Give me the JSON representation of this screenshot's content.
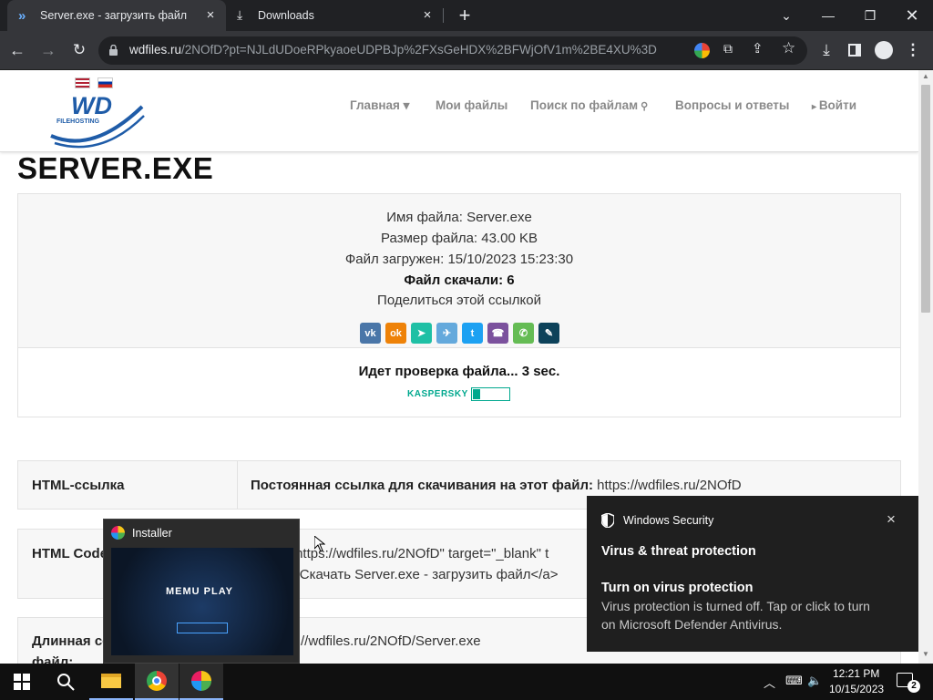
{
  "browser": {
    "tabs": [
      {
        "title": "Server.exe - загрузить файл",
        "active": true
      },
      {
        "title": "Downloads",
        "active": false
      }
    ],
    "url": {
      "host": "wdfiles.ru",
      "path": "/2NOfD?pt=NJLdUDoeRPkyaoeUDPBJp%2FXsGeHDX%2BFWjOfV1m%2BE4XU%3D"
    }
  },
  "site": {
    "logo_text": "WD",
    "logo_sub": "FILEHOSTING",
    "nav": [
      "Главная",
      "Мои файлы",
      "Поиск по файлам",
      "Вопросы и ответы",
      "Войти"
    ]
  },
  "file": {
    "title": "SERVER.EXE",
    "name_line": "Имя файла: Server.exe",
    "size_line": "Размер файла: 43.00 KB",
    "uploaded_line": "Файл загружен: 15/10/2023 15:23:30",
    "downloads_line": "Файл скачали: 6",
    "share_label": "Поделиться этой ссылкой",
    "share_buttons": [
      "vk",
      "odnoklassniki",
      "yandex",
      "telegram",
      "twitter",
      "viber",
      "whatsapp",
      "livejournal"
    ],
    "check_text": "Идет проверка файла... 3 sec.",
    "kaspersky": "KASPERSKY"
  },
  "links": [
    {
      "label": "HTML-ссылка",
      "value_bold": "Постоянная ссылка для скачивания на этот файл:",
      "value": "https://wdfiles.ru/2NOfD"
    },
    {
      "label": "HTML Code",
      "value_line1": "=\"https://wdfiles.ru/2NOfD\" target=\"_blank\" t",
      "value_line2": ">Скачать Server.exe - загрузить файл</a>"
    },
    {
      "label_line1": "Длинная сс",
      "label_line2": "файл:",
      "value": "//wdfiles.ru/2NOfD/Server.exe"
    }
  ],
  "installer": {
    "title": "Installer",
    "brand": "MEMU PLAY"
  },
  "toast": {
    "app": "Windows Security",
    "heading": "Virus & threat protection",
    "subheading": "Turn on virus protection",
    "body_line1": "Virus protection is turned off. Tap or click to turn",
    "body_line2": "on Microsoft Defender Antivirus."
  },
  "taskbar": {
    "time": "12:21 PM",
    "date": "10/15/2023",
    "notifications": "2"
  },
  "colors": {
    "vk": "#4a76a8",
    "ok": "#ee8208",
    "yandex": "#1fc0a5",
    "telegram": "#64a9dc",
    "twitter": "#1da1f2",
    "viber": "#7b519d",
    "whatsapp": "#65bc54",
    "lj": "#0d425a"
  }
}
